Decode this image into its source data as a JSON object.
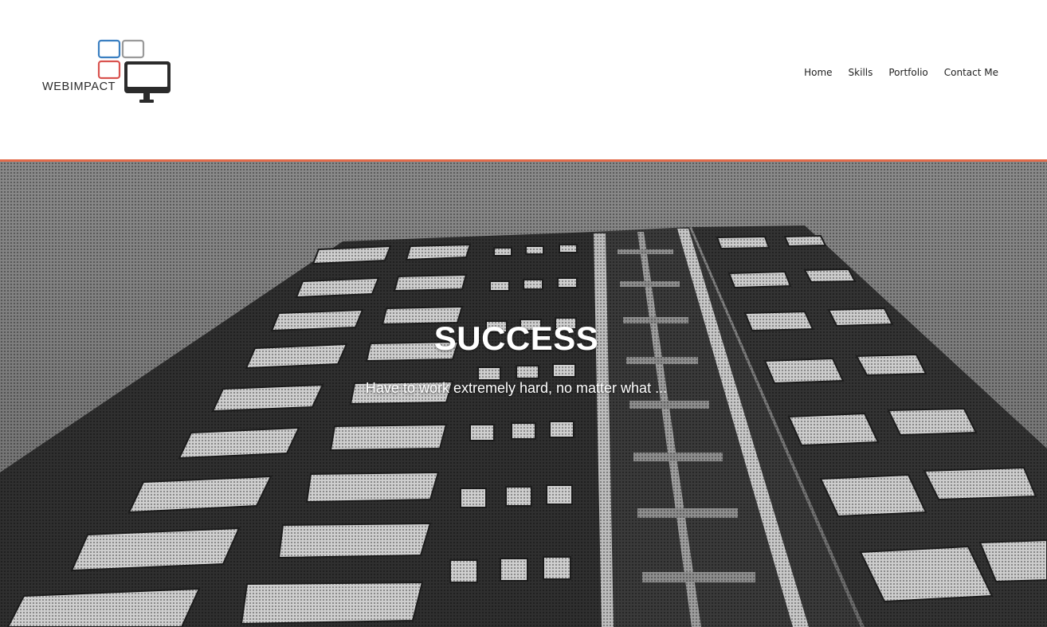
{
  "header": {
    "logo": {
      "text": "WEBIMPACT",
      "icon": "monitor-icon",
      "square_colors": [
        "#3a7fc1",
        "#9a9a9a",
        "#d9534f"
      ]
    },
    "nav": {
      "items": [
        {
          "label": "Home"
        },
        {
          "label": "Skills"
        },
        {
          "label": "Portfolio"
        },
        {
          "label": "Contact Me"
        }
      ]
    },
    "accent_color": "#e26a4a"
  },
  "hero": {
    "title": "SUCCESS",
    "subtitle": "Have to work extremely hard, no matter what ..."
  }
}
